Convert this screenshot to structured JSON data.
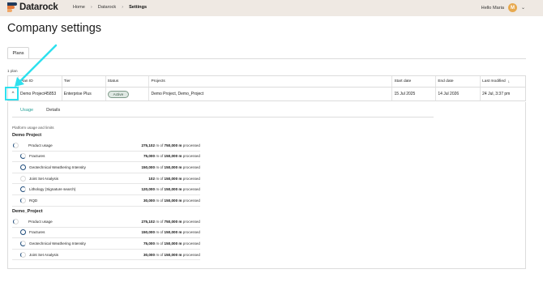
{
  "header": {
    "logo_text": "Datarock",
    "breadcrumb": [
      "Home",
      "Datarock",
      "Settings"
    ],
    "greeting": "Hello Maria",
    "avatar_initial": "M"
  },
  "page": {
    "title": "Company settings",
    "tab": "Plans",
    "plan_count": "1 plan"
  },
  "table": {
    "headers": [
      "Plan ID",
      "Tier",
      "Status",
      "Projects",
      "Start date",
      "End date",
      "Last modified"
    ],
    "row": {
      "plan_id": "Demo Project45853",
      "tier": "Enterprise Plus",
      "status": "Active",
      "projects": "Demo Project, Demo_Project",
      "start_date": "15 Jul 2025",
      "end_date": "14 Jul 2026",
      "last_modified": "24 Jul, 3:37 pm"
    }
  },
  "detail": {
    "tabs": [
      "Usage",
      "Details"
    ],
    "intro": "Platform usage and limits",
    "unit_text": "m of",
    "suffix": "processed",
    "groups": [
      {
        "name": "Demo Project",
        "rows": [
          {
            "label": "Product usage",
            "used": "275,102",
            "limit": "750,000 m",
            "level": "p1",
            "kind": "main"
          },
          {
            "label": "Fractures",
            "used": "75,000",
            "limit": "150,000 m",
            "level": "p2",
            "kind": "sub"
          },
          {
            "label": "Geotechnical Weathering Intensity",
            "used": "150,000",
            "limit": "150,000 m",
            "level": "p4",
            "kind": "sub"
          },
          {
            "label": "Joint Set Analysis",
            "used": "102",
            "limit": "150,000 m",
            "level": "p0",
            "kind": "sub"
          },
          {
            "label": "Lithology (Signature search)",
            "used": "120,000",
            "limit": "150,000 m",
            "level": "p3",
            "kind": "sub"
          },
          {
            "label": "RQD",
            "used": "30,000",
            "limit": "150,000 m",
            "level": "p1",
            "kind": "sub"
          }
        ]
      },
      {
        "name": "Demo_Project",
        "rows": [
          {
            "label": "Product usage",
            "used": "275,102",
            "limit": "750,000 m",
            "level": "p1",
            "kind": "main"
          },
          {
            "label": "Fractures",
            "used": "150,000",
            "limit": "150,000 m",
            "level": "p4",
            "kind": "sub"
          },
          {
            "label": "Geotechnical Weathering Intensity",
            "used": "75,000",
            "limit": "150,000 m",
            "level": "p2",
            "kind": "sub"
          },
          {
            "label": "Joint Set Analysis",
            "used": "30,000",
            "limit": "150,000 m",
            "level": "p1",
            "kind": "sub"
          }
        ]
      }
    ]
  },
  "annotation": {
    "color": "#2ee0ee"
  }
}
